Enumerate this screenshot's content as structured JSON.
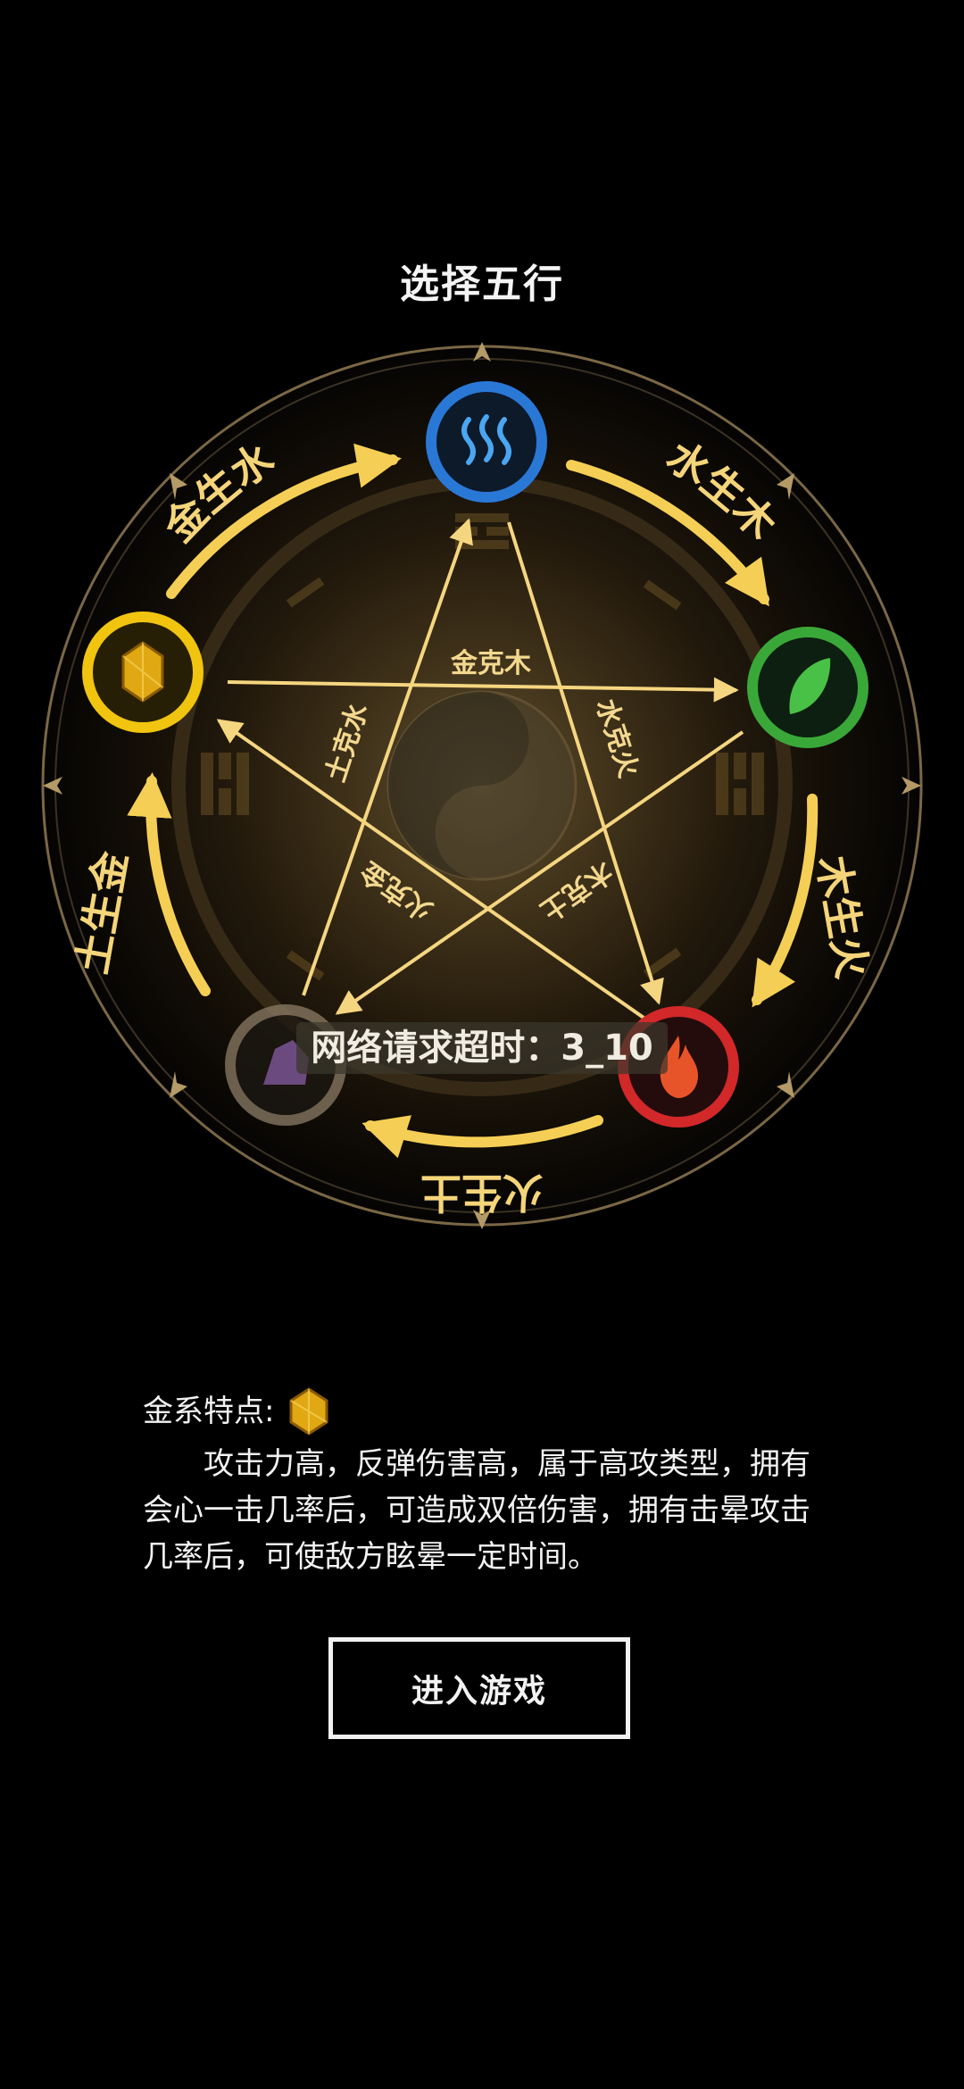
{
  "page": {
    "title": "选择五行"
  },
  "wheel": {
    "generating": [
      {
        "id": "metal-water",
        "text": "金生水"
      },
      {
        "id": "water-wood",
        "text": "水生木"
      },
      {
        "id": "wood-fire",
        "text": "木生火"
      },
      {
        "id": "fire-earth",
        "text": "火生土"
      },
      {
        "id": "earth-metal",
        "text": "土生金"
      }
    ],
    "overcoming": [
      {
        "id": "metal-wood",
        "text": "金克木"
      },
      {
        "id": "earth-water",
        "text": "土克水"
      },
      {
        "id": "water-fire",
        "text": "水克火"
      },
      {
        "id": "fire-metal",
        "text": "火克金"
      },
      {
        "id": "wood-earth",
        "text": "木克土"
      }
    ],
    "elements": [
      {
        "id": "water",
        "icon": "water-waves-icon",
        "color": "#2a78d6"
      },
      {
        "id": "wood",
        "icon": "leaf-icon",
        "color": "#3aa838"
      },
      {
        "id": "fire",
        "icon": "flame-icon",
        "color": "#d2282a"
      },
      {
        "id": "earth",
        "icon": "stone-icon",
        "color": "#8c7c66"
      },
      {
        "id": "metal",
        "icon": "gold-crystal-icon",
        "color": "#f1c40f"
      }
    ],
    "selected": "metal"
  },
  "toast": {
    "text": "网络请求超时：3_10"
  },
  "description": {
    "heading": "金系特点:",
    "icon": "gold-crystal-icon",
    "body": "攻击力高，反弹伤害高，属于高攻类型，拥有会心一击几率后，可造成双倍伤害，拥有击晕攻击几率后，可使敌方眩晕一定时间。"
  },
  "actions": {
    "enter_label": "进入游戏"
  },
  "colors": {
    "background": "#000000",
    "gold": "#f5d16a",
    "text": "#f2f2f2"
  }
}
